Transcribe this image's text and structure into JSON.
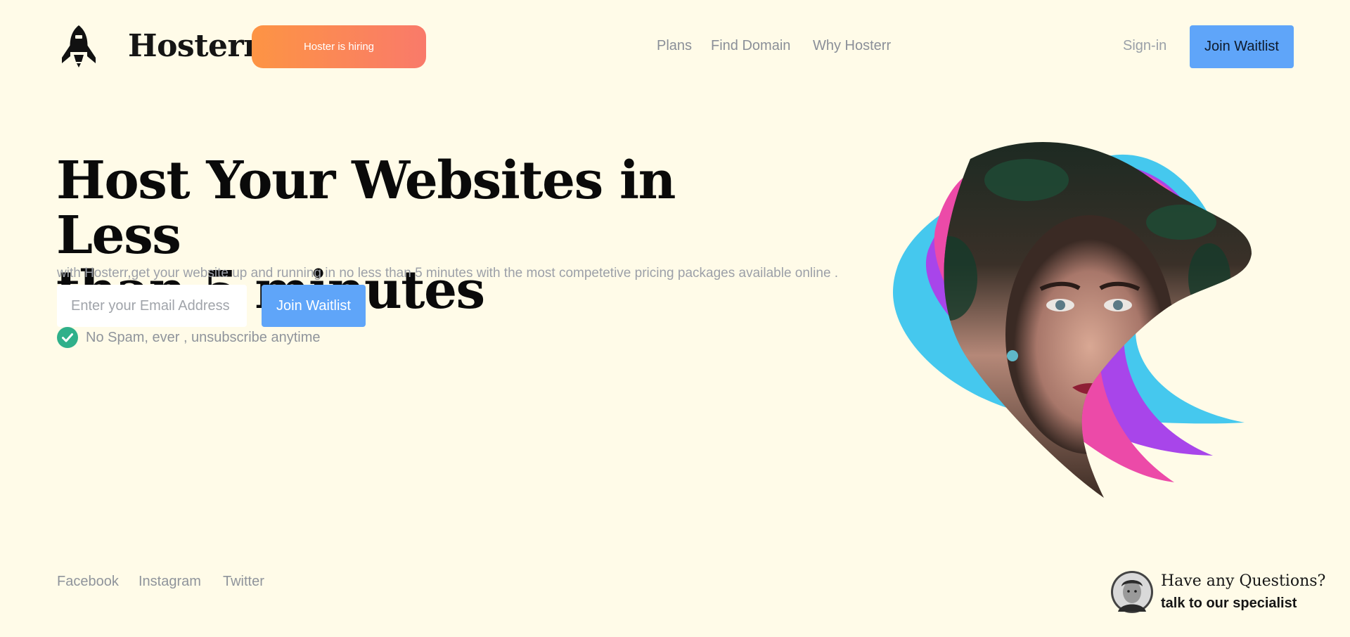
{
  "brand": {
    "name": "Hosterr",
    "logo_icon": "rocket-icon",
    "hiring_label": "Hoster is hiring"
  },
  "nav": {
    "items": [
      {
        "label": "Plans"
      },
      {
        "label": "Find Domain"
      },
      {
        "label": "Why Hosterr"
      }
    ],
    "signin_label": "Sign-in",
    "join_label": "Join Waitlist"
  },
  "hero": {
    "headline_line1": "Host Your Websites in Less",
    "headline_line2": "than 5 minutes",
    "subtext": "with Hosterr,get your website up and running in no less than 5 minutes with the most competetive pricing packages available online .",
    "email_placeholder": "Enter your Email Address",
    "email_value": "",
    "join_label": "Join Waitlist",
    "nospam_text": "No Spam, ever , unsubscribe anytime",
    "check_icon": "check-circle-icon"
  },
  "footer": {
    "social": [
      {
        "label": "Facebook"
      },
      {
        "label": "Instagram"
      },
      {
        "label": "Twitter"
      }
    ],
    "question_title": "Have any Questions?",
    "question_sub": "talk to our specialist"
  },
  "colors": {
    "background": "#fffbe8",
    "accent_blue": "#5fa5f9",
    "hiring_gradient_start": "#fd9444",
    "hiring_gradient_end": "#f97a6a",
    "check_green": "#2fb08a",
    "ribbon_cyan": "#45c8ee",
    "ribbon_purple": "#a845ea",
    "ribbon_pink": "#ec4aa8"
  }
}
